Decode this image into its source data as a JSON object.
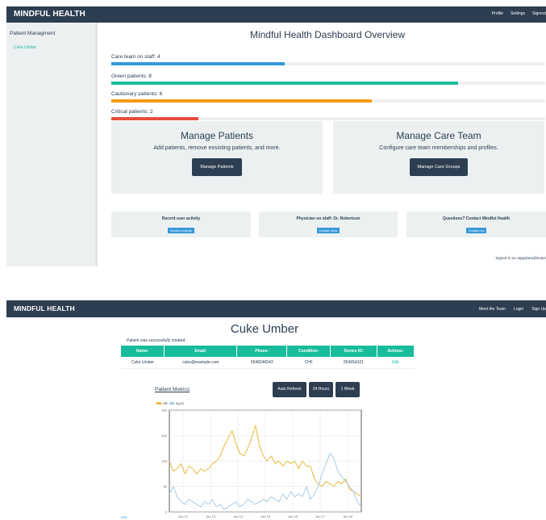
{
  "screen1": {
    "brand": "MINDFUL HEALTH",
    "nav": [
      "Profile",
      "Settings",
      "Signout"
    ],
    "sidebar": {
      "title": "Patient Managment",
      "items": [
        "Cuke Umber"
      ]
    },
    "title": "Mindful Health Dashboard Overview",
    "stats": [
      {
        "label": "Care team on staff: 4",
        "progress": 0.4,
        "color": "#3498db"
      },
      {
        "label": "Green patients: 8",
        "progress": 0.8,
        "color": "#18bc9c"
      },
      {
        "label": "Cautionary patients: 6",
        "progress": 0.6,
        "color": "#f39c12"
      },
      {
        "label": "Critical patients: 2",
        "progress": 0.2,
        "color": "#e74c3c"
      }
    ],
    "panels": [
      {
        "heading": "Manage Patients",
        "text": "Add patients, remove exsisting patients, and more.",
        "button": "Manage Patients"
      },
      {
        "heading": "Manage Care Team",
        "text": "Configure care team memberships and profiles.",
        "button": "Manage Care Groups"
      }
    ],
    "cards": [
      {
        "title": "Recent user activity",
        "button": "Review Activity"
      },
      {
        "title": "Physician on staff: Dr. Robertson",
        "button": "Contact Now"
      },
      {
        "title": "Questions? Contact Mindful Health",
        "button": "Contact Us"
      }
    ],
    "signed_in": "Signed in as cappybara@exam"
  },
  "screen2": {
    "brand": "MINDFUL HEALTH",
    "nav": [
      "Meet the Team",
      "Login",
      "Sign Up"
    ],
    "title": "Cuke Umber",
    "flash": "Patient was successfully created.",
    "table": {
      "headers": [
        "Name:",
        "Email:",
        "Phone:",
        "Condition:",
        "Device ID:",
        "Actions:"
      ],
      "rows": [
        [
          "Cuke Umber",
          "cuke@example.com",
          "6546546543",
          "CHF",
          "654654321",
          "Edit"
        ]
      ]
    },
    "metrics_link": "Patient Metrics",
    "buttons": [
      "Auto Refresh",
      "24 Hours",
      "1 Week"
    ],
    "legend": [
      "HR",
      "SpO2"
    ],
    "colors": {
      "hr": "#e8b93a",
      "spo2": "#a9cbe3"
    },
    "below_chart": "Edit"
  },
  "chart_data": {
    "type": "line",
    "title": "",
    "xlabel": "",
    "ylabel": "",
    "x_ticks": [
      "Jun 12",
      "Jun 13",
      "Jun 14",
      "Jun 15",
      "Jun 16",
      "Jun 17",
      "Jun 18"
    ],
    "y_ticks": [
      0,
      50,
      100,
      150,
      200
    ],
    "ylim": [
      0,
      200
    ],
    "grid": true,
    "legend_position": "top-left",
    "series": [
      {
        "name": "HR",
        "values": [
          100,
          80,
          85,
          95,
          75,
          90,
          85,
          75,
          85,
          80,
          85,
          95,
          100,
          110,
          130,
          145,
          160,
          135,
          115,
          110,
          125,
          145,
          170,
          130,
          110,
          100,
          110,
          95,
          100,
          90,
          100,
          95,
          100,
          85,
          100,
          90,
          90,
          65,
          55,
          50,
          60,
          55,
          50,
          60,
          55,
          65,
          45,
          40,
          35,
          30
        ]
      },
      {
        "name": "SpO2",
        "values": [
          35,
          50,
          30,
          20,
          15,
          25,
          20,
          15,
          10,
          20,
          15,
          25,
          10,
          15,
          5,
          10,
          15,
          20,
          10,
          15,
          25,
          20,
          15,
          20,
          25,
          20,
          30,
          25,
          20,
          35,
          25,
          40,
          30,
          35,
          30,
          50,
          25,
          35,
          50,
          75,
          95,
          115,
          105,
          80,
          70,
          60,
          50,
          40,
          20,
          10
        ]
      }
    ]
  }
}
